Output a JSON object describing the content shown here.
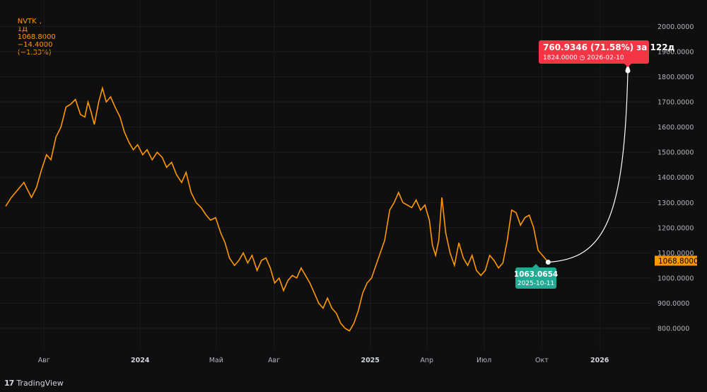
{
  "header": {
    "symbol": "NVTK",
    "interval": "1Д",
    "last": "1068.8000",
    "change": "−14.4000",
    "change_pct": "(−1.33%)"
  },
  "brand": {
    "logo": "17",
    "name": "TradingView"
  },
  "colors": {
    "background": "#0f0f0f",
    "line": "#ff9800",
    "projection": "#ffffff",
    "target_badge": "#f23645",
    "start_badge": "#22ab94",
    "price_tag": "#ff9800"
  },
  "price_tag": "1068.8000",
  "projection": {
    "target_label": "760.9346 (71.58%) за 122д",
    "target_sub": "1824.0000 ◷ 2026-02-10",
    "start_price": "1063.0654",
    "start_date": "2025-10-11",
    "start_value": 1063.0654,
    "target_value": 1824.0
  },
  "chart_data": {
    "type": "line",
    "title": "",
    "xlabel": "",
    "ylabel": "",
    "ylim": [
      700,
      2050
    ],
    "yticks": [
      "800.0000",
      "900.0000",
      "1000.0000",
      "1100.0000",
      "1200.0000",
      "1300.0000",
      "1400.0000",
      "1500.0000",
      "1600.0000",
      "1700.0000",
      "1800.0000",
      "1900.0000",
      "2000.0000"
    ],
    "xticks": [
      {
        "label": "Авг",
        "date": "2023-08-01",
        "year": false
      },
      {
        "label": "2024",
        "date": "2024-01-01",
        "year": true
      },
      {
        "label": "Май",
        "date": "2024-05-01",
        "year": false
      },
      {
        "label": "Авг",
        "date": "2024-08-01",
        "year": false
      },
      {
        "label": "2025",
        "date": "2025-01-01",
        "year": true
      },
      {
        "label": "Апр",
        "date": "2025-04-01",
        "year": false
      },
      {
        "label": "Июл",
        "date": "2025-07-01",
        "year": false
      },
      {
        "label": "Окт",
        "date": "2025-10-01",
        "year": false
      },
      {
        "label": "2026",
        "date": "2026-01-01",
        "year": true
      }
    ],
    "x_range": [
      "2023-06-01",
      "2026-03-25"
    ],
    "series": [
      {
        "values": [
          [
            "2023-06-01",
            1285
          ],
          [
            "2023-06-10",
            1320
          ],
          [
            "2023-06-20",
            1350
          ],
          [
            "2023-06-30",
            1380
          ],
          [
            "2023-07-05",
            1355
          ],
          [
            "2023-07-12",
            1320
          ],
          [
            "2023-07-20",
            1360
          ],
          [
            "2023-07-28",
            1430
          ],
          [
            "2023-08-05",
            1490
          ],
          [
            "2023-08-12",
            1470
          ],
          [
            "2023-08-20",
            1560
          ],
          [
            "2023-08-28",
            1600
          ],
          [
            "2023-09-05",
            1680
          ],
          [
            "2023-09-12",
            1690
          ],
          [
            "2023-09-20",
            1710
          ],
          [
            "2023-09-28",
            1650
          ],
          [
            "2023-10-05",
            1640
          ],
          [
            "2023-10-10",
            1700
          ],
          [
            "2023-10-15",
            1660
          ],
          [
            "2023-10-20",
            1610
          ],
          [
            "2023-10-27",
            1700
          ],
          [
            "2023-11-02",
            1755
          ],
          [
            "2023-11-08",
            1700
          ],
          [
            "2023-11-15",
            1720
          ],
          [
            "2023-11-22",
            1680
          ],
          [
            "2023-11-30",
            1640
          ],
          [
            "2023-12-07",
            1580
          ],
          [
            "2023-12-14",
            1540
          ],
          [
            "2023-12-21",
            1510
          ],
          [
            "2023-12-28",
            1530
          ],
          [
            "2024-01-05",
            1490
          ],
          [
            "2024-01-12",
            1510
          ],
          [
            "2024-01-20",
            1470
          ],
          [
            "2024-01-28",
            1500
          ],
          [
            "2024-02-05",
            1480
          ],
          [
            "2024-02-12",
            1440
          ],
          [
            "2024-02-20",
            1460
          ],
          [
            "2024-02-28",
            1410
          ],
          [
            "2024-03-07",
            1380
          ],
          [
            "2024-03-14",
            1420
          ],
          [
            "2024-03-22",
            1340
          ],
          [
            "2024-03-30",
            1300
          ],
          [
            "2024-04-07",
            1280
          ],
          [
            "2024-04-15",
            1250
          ],
          [
            "2024-04-22",
            1230
          ],
          [
            "2024-04-30",
            1240
          ],
          [
            "2024-05-08",
            1180
          ],
          [
            "2024-05-15",
            1140
          ],
          [
            "2024-05-22",
            1080
          ],
          [
            "2024-05-30",
            1050
          ],
          [
            "2024-06-06",
            1070
          ],
          [
            "2024-06-13",
            1100
          ],
          [
            "2024-06-20",
            1060
          ],
          [
            "2024-06-27",
            1090
          ],
          [
            "2024-07-05",
            1030
          ],
          [
            "2024-07-12",
            1070
          ],
          [
            "2024-07-19",
            1080
          ],
          [
            "2024-07-26",
            1040
          ],
          [
            "2024-08-02",
            980
          ],
          [
            "2024-08-09",
            1000
          ],
          [
            "2024-08-16",
            950
          ],
          [
            "2024-08-23",
            990
          ],
          [
            "2024-08-30",
            1010
          ],
          [
            "2024-09-06",
            1000
          ],
          [
            "2024-09-13",
            1040
          ],
          [
            "2024-09-20",
            1010
          ],
          [
            "2024-09-27",
            980
          ],
          [
            "2024-10-04",
            940
          ],
          [
            "2024-10-11",
            900
          ],
          [
            "2024-10-18",
            880
          ],
          [
            "2024-10-25",
            920
          ],
          [
            "2024-11-01",
            880
          ],
          [
            "2024-11-08",
            860
          ],
          [
            "2024-11-15",
            820
          ],
          [
            "2024-11-22",
            800
          ],
          [
            "2024-11-29",
            790
          ],
          [
            "2024-12-06",
            820
          ],
          [
            "2024-12-13",
            870
          ],
          [
            "2024-12-20",
            940
          ],
          [
            "2024-12-27",
            980
          ],
          [
            "2025-01-03",
            1000
          ],
          [
            "2025-01-10",
            1050
          ],
          [
            "2025-01-17",
            1100
          ],
          [
            "2025-01-24",
            1150
          ],
          [
            "2025-02-01",
            1270
          ],
          [
            "2025-02-08",
            1300
          ],
          [
            "2025-02-15",
            1340
          ],
          [
            "2025-02-22",
            1300
          ],
          [
            "2025-03-01",
            1290
          ],
          [
            "2025-03-08",
            1280
          ],
          [
            "2025-03-15",
            1310
          ],
          [
            "2025-03-22",
            1270
          ],
          [
            "2025-03-29",
            1290
          ],
          [
            "2025-04-05",
            1230
          ],
          [
            "2025-04-10",
            1130
          ],
          [
            "2025-04-15",
            1090
          ],
          [
            "2025-04-20",
            1150
          ],
          [
            "2025-04-25",
            1320
          ],
          [
            "2025-05-01",
            1180
          ],
          [
            "2025-05-08",
            1100
          ],
          [
            "2025-05-15",
            1050
          ],
          [
            "2025-05-22",
            1140
          ],
          [
            "2025-05-29",
            1080
          ],
          [
            "2025-06-05",
            1050
          ],
          [
            "2025-06-12",
            1090
          ],
          [
            "2025-06-19",
            1030
          ],
          [
            "2025-06-26",
            1010
          ],
          [
            "2025-07-03",
            1030
          ],
          [
            "2025-07-10",
            1090
          ],
          [
            "2025-07-17",
            1070
          ],
          [
            "2025-07-24",
            1040
          ],
          [
            "2025-07-31",
            1060
          ],
          [
            "2025-08-07",
            1150
          ],
          [
            "2025-08-14",
            1270
          ],
          [
            "2025-08-21",
            1260
          ],
          [
            "2025-08-28",
            1210
          ],
          [
            "2025-09-04",
            1240
          ],
          [
            "2025-09-11",
            1250
          ],
          [
            "2025-09-18",
            1200
          ],
          [
            "2025-09-25",
            1110
          ],
          [
            "2025-10-02",
            1090
          ],
          [
            "2025-10-11",
            1063.0654
          ]
        ]
      }
    ]
  }
}
